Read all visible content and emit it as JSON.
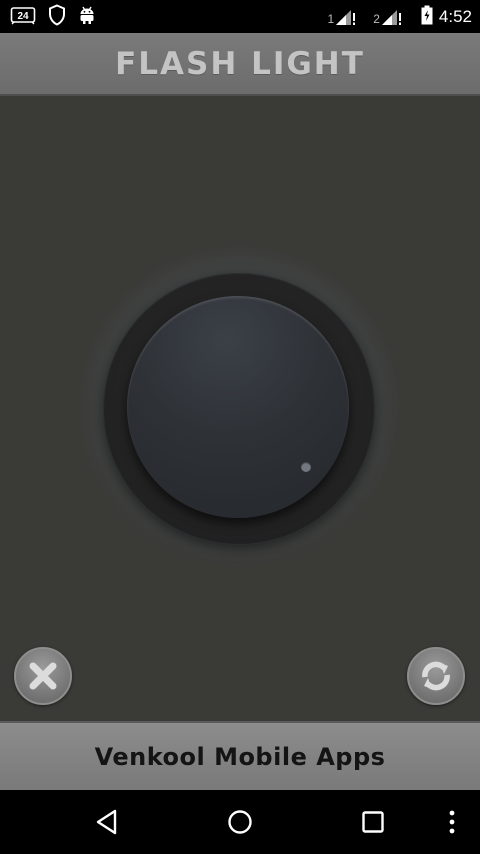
{
  "status_bar": {
    "left_icons": [
      "calendar-24-icon",
      "shield-icon",
      "android-icon"
    ],
    "sim1_label": "1",
    "sim2_label": "2",
    "battery_icon": "battery-charging-icon",
    "time": "4:52"
  },
  "app": {
    "title": "FLASH LIGHT",
    "knob_icon": "power-knob",
    "close_icon": "close-icon",
    "refresh_icon": "refresh-icon"
  },
  "footer": {
    "text": "Venkool Mobile Apps"
  },
  "nav_bar": {
    "icons": [
      "back-icon",
      "home-icon",
      "recents-icon",
      "more-vert-icon"
    ]
  },
  "colors": {
    "background": "#3a3a37",
    "title_bar": "#727272",
    "title_text": "#c4c4c4",
    "footer": "#838383",
    "footer_text": "#141414"
  }
}
